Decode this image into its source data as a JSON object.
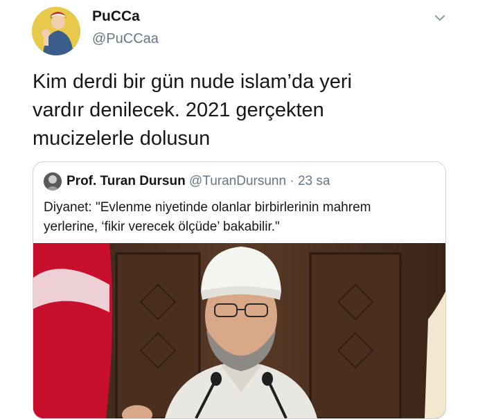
{
  "tweet": {
    "display_name": "PuCCa",
    "handle": "@PuCCaa",
    "text_lines": [
      "Kim derdi bir gün nude islam’da yeri",
      "vardır denilecek. 2021 gerçekten",
      "mucizelerle dolusun"
    ]
  },
  "quoted_tweet": {
    "display_name": "Prof. Turan Dursun",
    "handle": "@TuranDursunn",
    "separator": "·",
    "time": "23 sa",
    "text_lines": [
      "Diyanet: \"Evlenme niyetinde olanlar birbirlerinin mahrem",
      "yerlerine, ‘fikir verecek ölçüde’ bakabilir.\""
    ]
  },
  "icons": {
    "more": "chevron-down-icon"
  },
  "colors": {
    "primary_text": "#14171a",
    "secondary_text": "#657786",
    "border": "#ccd6dd"
  }
}
